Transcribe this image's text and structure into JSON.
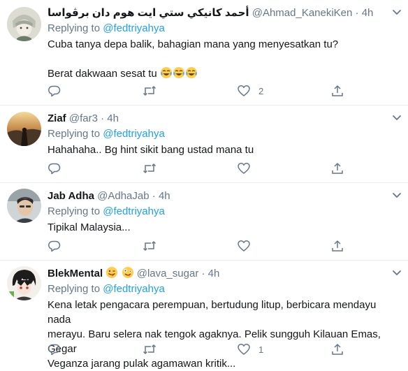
{
  "accent_color": "#1da1f2",
  "tweets": [
    {
      "name": "أحمد كانيكي ستي ايت هوم دان برڤواسا",
      "handle": "@Ahmad_KanekiKen",
      "sep": "·",
      "time": "4h",
      "reply_prefix": "Replying to",
      "reply_to": "@fedtriyahya",
      "text_line1": "Cuba tanya depa balik, bahagian mana yang menyesatkan tu?",
      "text_line2": "Berat dakwaan sesat tu",
      "text_emojis": [
        "joy-emoji",
        "joy-emoji",
        "joy-emoji"
      ],
      "like_count": "2"
    },
    {
      "name": "Ziaf",
      "handle": "@far3",
      "sep": "·",
      "time": "4h",
      "reply_prefix": "Replying to",
      "reply_to": "@fedtriyahya",
      "text": "Hahahaha.. Bg hint sikit bang ustad mana tu",
      "like_count": ""
    },
    {
      "name": "Jab Adha",
      "handle": "@AdhaJab",
      "sep": "·",
      "time": "4h",
      "reply_prefix": "Replying to",
      "reply_to": "@fedtriyahya",
      "text": "Tipikal Malaysia...",
      "like_count": ""
    },
    {
      "name": "BlekMental",
      "name_emojis": [
        "wink-tongue-emoji",
        "zany-face-emoji"
      ],
      "handle": "@lava_sugar",
      "sep": "·",
      "time": "4h",
      "reply_prefix": "Replying to",
      "reply_to": "@fedtriyahya",
      "text_line1": "Kena letak pengacara perempuan, bertudung litup, berbicara mendayu nada",
      "text_line2": "merayu. Baru selera nak tengok agaknya. Pelik sungguh Kilauan Emas, Gegar",
      "text_line3": "Veganza jarang pulak agamawan kritik...",
      "like_count": "1"
    }
  ]
}
